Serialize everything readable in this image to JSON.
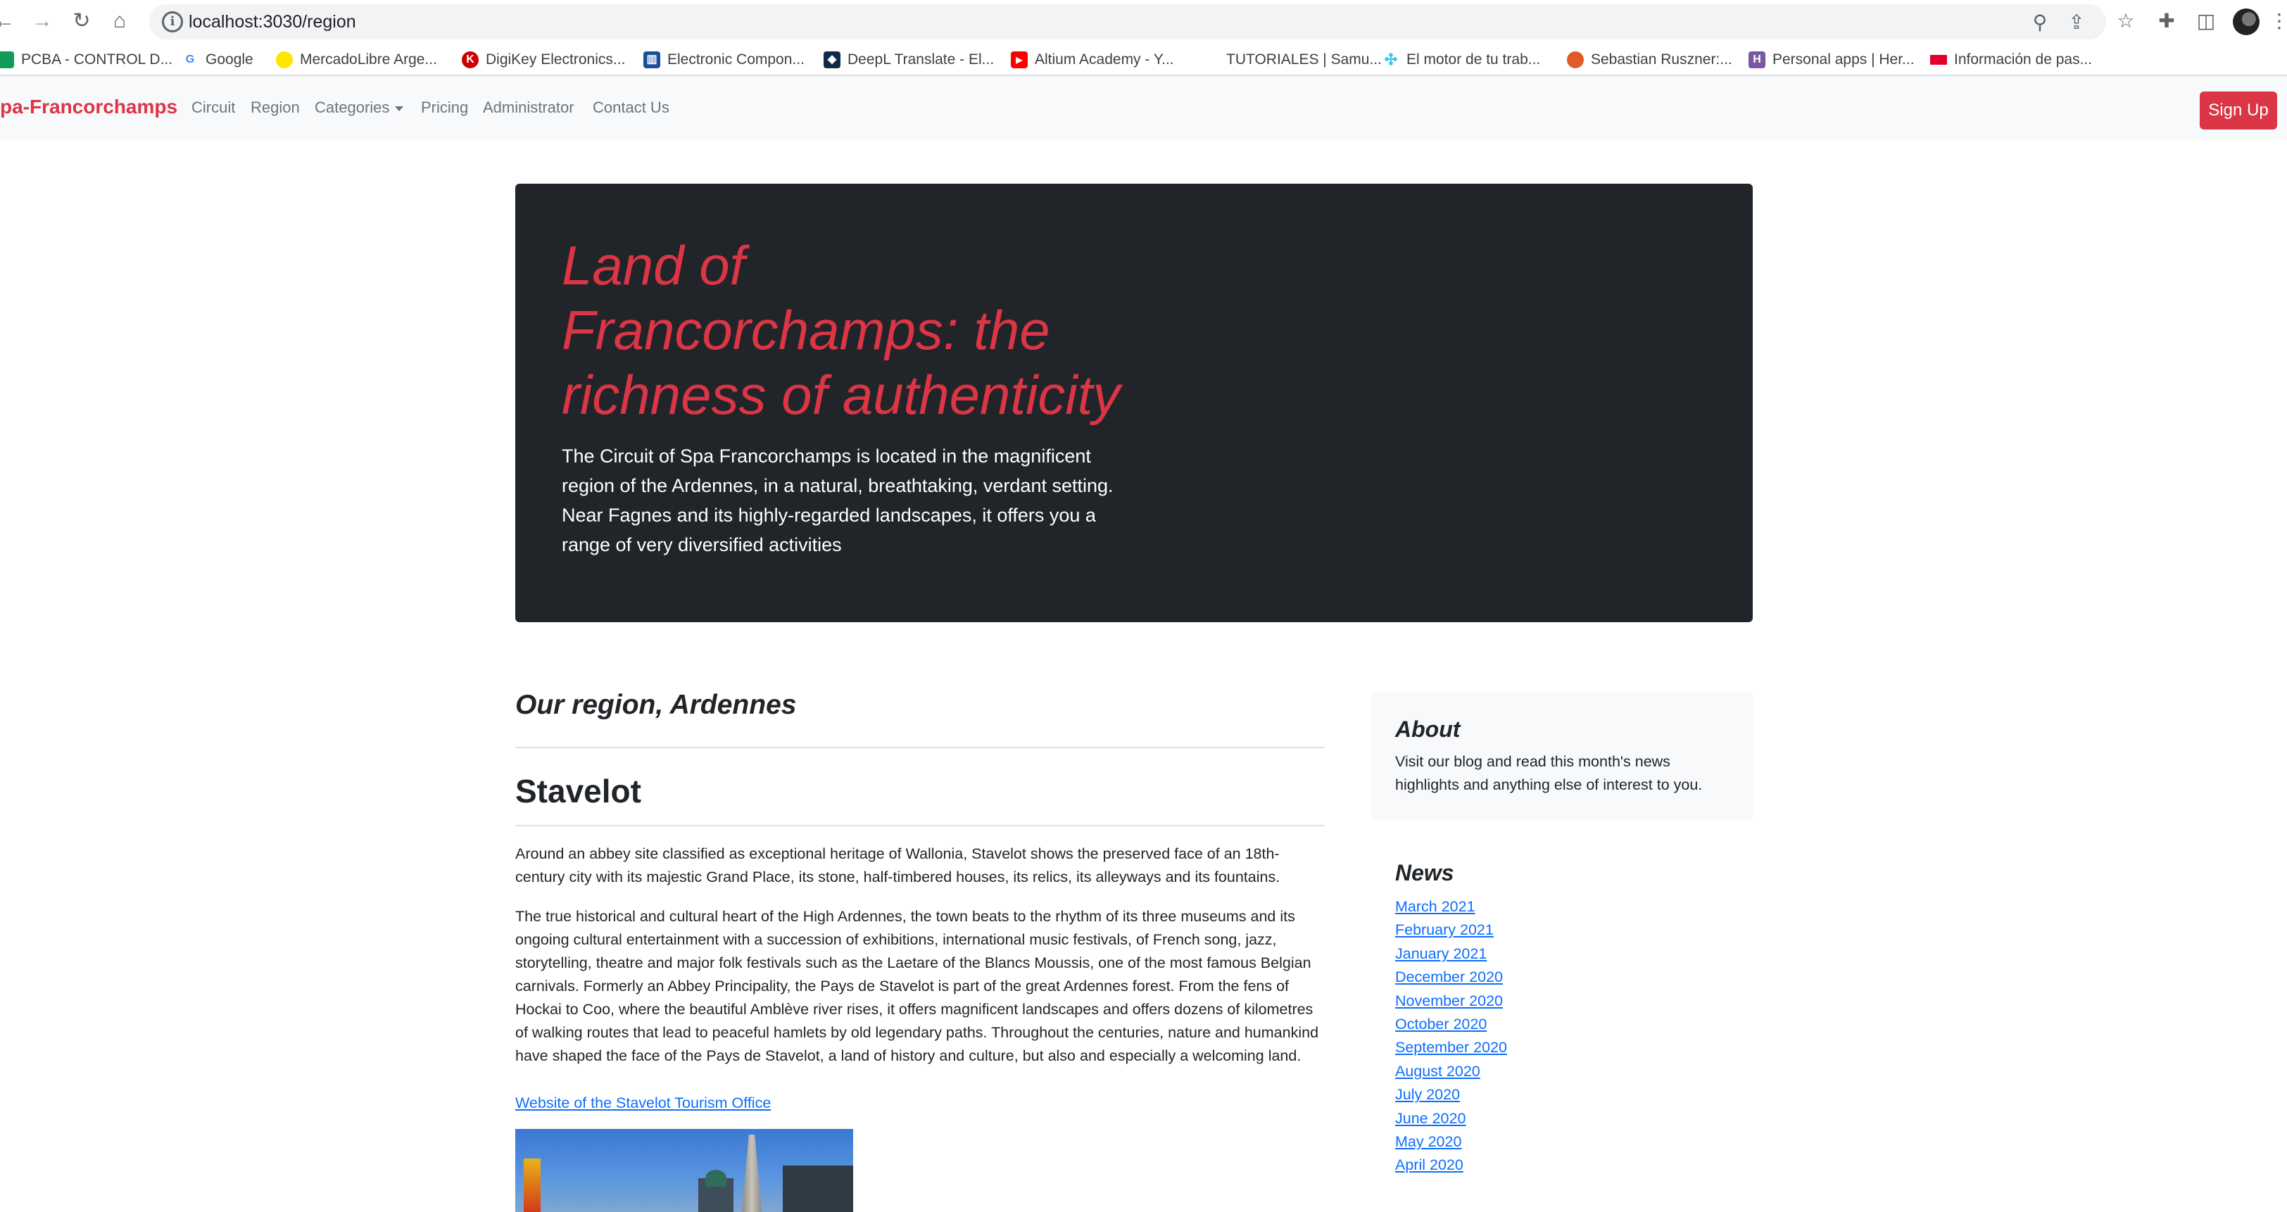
{
  "browser": {
    "url": "localhost:3030/region",
    "bookmarks": [
      {
        "label": "PCBA - CONTROL D...",
        "icon": "sheets-icon",
        "color": "#0f9d58"
      },
      {
        "label": "Google",
        "icon": "google-icon",
        "color": "#4285f4"
      },
      {
        "label": "MercadoLibre Arge...",
        "icon": "mercadolibre-icon",
        "color": "#ffe600"
      },
      {
        "label": "DigiKey Electronics...",
        "icon": "digikey-icon",
        "color": "#cc0000"
      },
      {
        "label": "Electronic Compon...",
        "icon": "chart-icon",
        "color": "#1a4f9c"
      },
      {
        "label": "DeepL Translate - El...",
        "icon": "deepl-icon",
        "color": "#0f2b46"
      },
      {
        "label": "Altium Academy - Y...",
        "icon": "youtube-icon",
        "color": "#ff0000"
      },
      {
        "label": "TUTORIALES | Samu...",
        "icon": "",
        "color": ""
      },
      {
        "label": "El motor de tu trab...",
        "icon": "slack-icon",
        "color": "#36c5f0"
      },
      {
        "label": "Sebastian Ruszner:...",
        "icon": "globe-icon",
        "color": "#e05a2a"
      },
      {
        "label": "Personal apps | Her...",
        "icon": "heroku-icon",
        "color": "#79589f"
      },
      {
        "label": "Información de pas...",
        "icon": "flag-icon",
        "color": "#e4002b"
      }
    ]
  },
  "navbar": {
    "brand": "pa-Francorchamps",
    "links": [
      "Circuit",
      "Region",
      "Categories",
      "Pricing",
      "Administrator",
      "Contact Us"
    ],
    "signup_label": "Sign Up"
  },
  "hero": {
    "title": "Land of Francorchamps: the richness of authenticity",
    "lead_line1": "The Circuit of Spa Francorchamps is located in the magnificent region of the Ardennes, in a natural, breathtaking, verdant setting.",
    "lead_line2": "Near Fagnes and its highly-regarded landscapes, it offers you a range of very diversified activities"
  },
  "main": {
    "section_heading": "Our region, Ardennes",
    "post_title": "Stavelot",
    "paragraph1": "Around an abbey site classified as exceptional heritage of Wallonia, Stavelot shows the preserved face of an 18th-century city with its majestic Grand Place, its stone, half-timbered houses, its relics, its alleyways and its fountains.",
    "paragraph2": "The true historical and cultural heart of the High Ardennes, the town beats to the rhythm of its three museums and its ongoing cultural entertainment with a succession of exhibitions, international music festivals, of French song, jazz, storytelling, theatre and major folk festivals such as the Laetare of the Blancs Moussis, one of the most famous Belgian carnivals. Formerly an Abbey Principality, the Pays de Stavelot is part of the great Ardennes forest. From the fens of Hockai to Coo, where the beautiful Amblève river rises, it offers magnificent landscapes and offers dozens of kilometres of walking routes that lead to peaceful hamlets by old legendary paths. Throughout the centuries, nature and humankind have shaped the face of the Pays de Stavelot, a land of history and culture, but also and especially a welcoming land.",
    "link_text": "Website of the Stavelot Tourism Office"
  },
  "sidebar": {
    "about_title": "About",
    "about_text": "Visit our blog and read this month's news highlights and anything else of interest to you.",
    "news_title": "News",
    "news_items": [
      "March 2021",
      "February 2021",
      "January 2021",
      "December 2020",
      "November 2020",
      "October 2020",
      "September 2020",
      "August 2020",
      "July 2020",
      "June 2020",
      "May 2020",
      "April 2020"
    ]
  },
  "colors": {
    "brand": "#dc3545",
    "hero_bg": "#212529",
    "link": "#0d6efd"
  }
}
